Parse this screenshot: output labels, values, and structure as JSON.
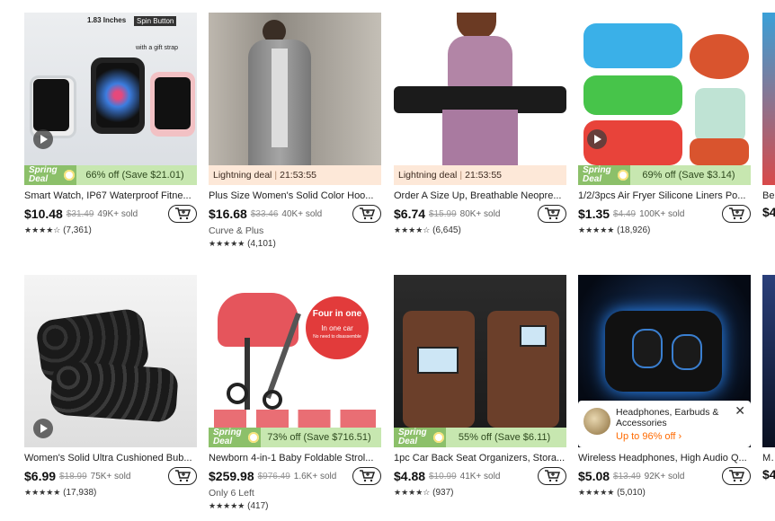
{
  "products": [
    {
      "title": "Smart Watch, IP67 Waterproof Fitne...",
      "price": "$10.48",
      "orig": "$31.49",
      "sold": "49K+ sold",
      "badge": {
        "type": "spring",
        "text": "66% off (Save $21.01)",
        "l1": "Spring",
        "l2": "Deal"
      },
      "extra": "",
      "stars": "★★★★☆",
      "reviews": "(7,361)",
      "video": true,
      "overlay": {
        "t1": "1.83 Inches",
        "t2": "Spin Button",
        "t3": "with a gift strap"
      }
    },
    {
      "title": "Plus Size Women's Solid Color Hoo...",
      "price": "$16.68",
      "orig": "$33.46",
      "sold": "40K+ sold",
      "badge": {
        "type": "light",
        "text": "Lightning deal",
        "time": "21:53:55"
      },
      "extra": "Curve & Plus",
      "stars": "★★★★★",
      "reviews": "(4,101)",
      "video": false
    },
    {
      "title": "Order A Size Up, Breathable Neopre...",
      "price": "$6.74",
      "orig": "$15.99",
      "sold": "80K+ sold",
      "badge": {
        "type": "light",
        "text": "Lightning deal",
        "time": "21:53:55"
      },
      "extra": "",
      "stars": "★★★★☆",
      "reviews": "(6,645)",
      "video": false
    },
    {
      "title": "1/2/3pcs Air Fryer Silicone Liners Po...",
      "price": "$1.35",
      "orig": "$4.49",
      "sold": "100K+ sold",
      "badge": {
        "type": "spring",
        "text": "69% off (Save $3.14)",
        "l1": "Spring",
        "l2": "Deal"
      },
      "extra": "",
      "stars": "★★★★★",
      "reviews": "(18,926)",
      "video": true
    },
    {
      "title": "Women's Solid Ultra Cushioned Bub...",
      "price": "$6.99",
      "orig": "$18.99",
      "sold": "75K+ sold",
      "badge": null,
      "extra": "",
      "stars": "★★★★★",
      "reviews": "(17,938)",
      "video": true
    },
    {
      "title": "Newborn 4-in-1 Baby Foldable Strol...",
      "price": "$259.98",
      "orig": "$976.49",
      "sold": "1.6K+ sold",
      "badge": {
        "type": "spring",
        "text": "73% off (Save $716.51)",
        "l1": "Spring",
        "l2": "Deal"
      },
      "extra": "Only 6 Left",
      "stars": "★★★★★",
      "reviews": "(417)",
      "video": false,
      "overlay": {
        "t1": "Four in one",
        "t2": "In one car",
        "t3": "No need to disassemble"
      }
    },
    {
      "title": "1pc Car Back Seat Organizers, Stora...",
      "price": "$4.88",
      "orig": "$10.99",
      "sold": "41K+ sold",
      "badge": {
        "type": "spring",
        "text": "55% off (Save $6.11)",
        "l1": "Spring",
        "l2": "Deal"
      },
      "extra": "",
      "stars": "★★★★☆",
      "reviews": "(937)",
      "video": false
    },
    {
      "title": "Wireless Headphones, High Audio Q...",
      "price": "$5.08",
      "orig": "$13.49",
      "sold": "92K+ sold",
      "badge": null,
      "extra": "",
      "stars": "★★★★★",
      "reviews": "(5,010)",
      "video": false,
      "popup": {
        "text": "Headphones, Earbuds & Accessories",
        "link": "Up to 96% off ›"
      }
    }
  ],
  "edge": {
    "r1_title": "Be",
    "r1_price": "$4",
    "r2_title": "Mu",
    "r2_price": "$4"
  },
  "icons": {
    "cart": "cart-icon",
    "play": "play-icon",
    "close": "close-icon",
    "flower": "flower-icon"
  }
}
